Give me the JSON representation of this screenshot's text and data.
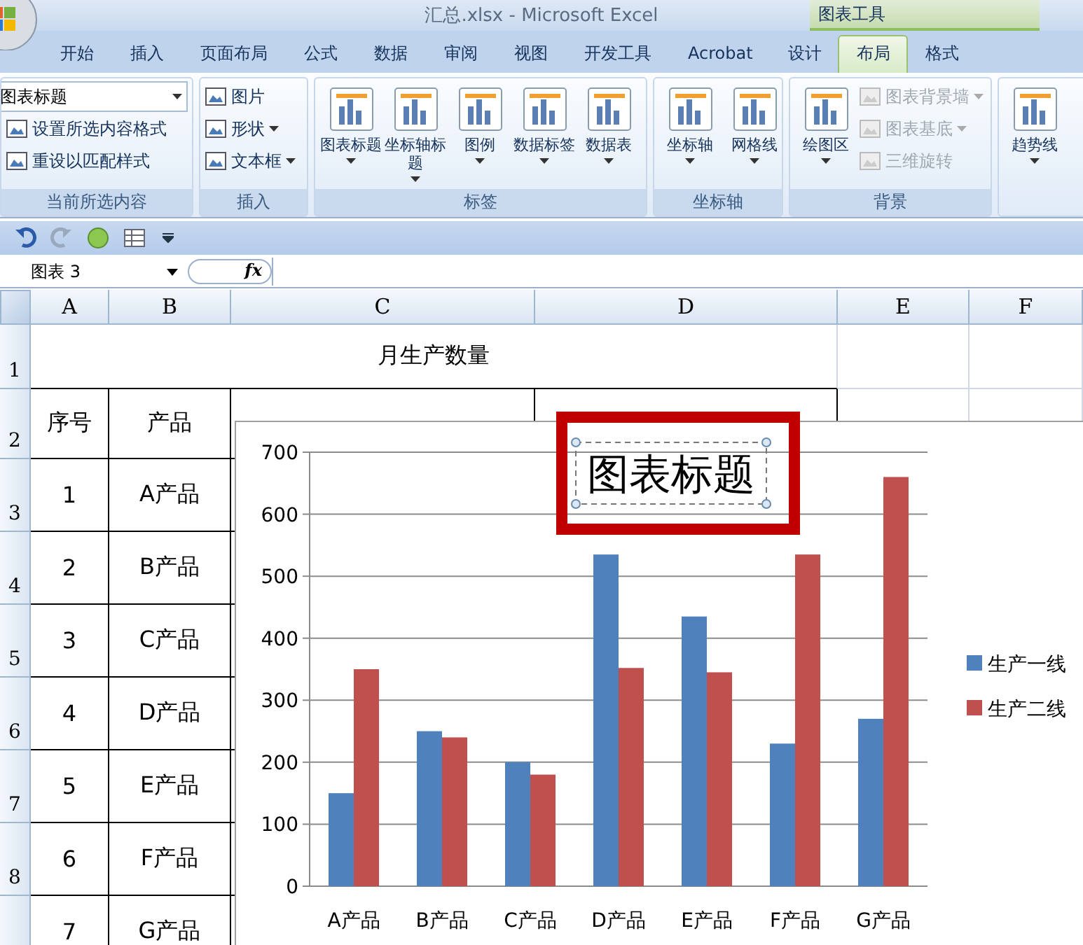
{
  "window": {
    "title": "汇总.xlsx - Microsoft Excel"
  },
  "contextual_group": "图表工具",
  "tabs": [
    {
      "label": "开始",
      "selected": false,
      "contextual": false
    },
    {
      "label": "插入",
      "selected": false,
      "contextual": false
    },
    {
      "label": "页面布局",
      "selected": false,
      "contextual": false
    },
    {
      "label": "公式",
      "selected": false,
      "contextual": false
    },
    {
      "label": "数据",
      "selected": false,
      "contextual": false
    },
    {
      "label": "审阅",
      "selected": false,
      "contextual": false
    },
    {
      "label": "视图",
      "selected": false,
      "contextual": false
    },
    {
      "label": "开发工具",
      "selected": false,
      "contextual": false
    },
    {
      "label": "Acrobat",
      "selected": false,
      "contextual": false
    },
    {
      "label": "设计",
      "selected": false,
      "contextual": true
    },
    {
      "label": "布局",
      "selected": true,
      "contextual": true
    },
    {
      "label": "格式",
      "selected": false,
      "contextual": true
    }
  ],
  "ribbon": [
    {
      "label": "当前所选内容",
      "items": [
        {
          "kind": "combo",
          "label": "图表标题"
        },
        {
          "kind": "small",
          "label": "设置所选内容格式",
          "dropdown": false,
          "disabled": false
        },
        {
          "kind": "small",
          "label": "重设以匹配样式",
          "dropdown": false,
          "disabled": false
        }
      ]
    },
    {
      "label": "插入",
      "items": [
        {
          "kind": "small",
          "label": "图片",
          "dropdown": false,
          "disabled": false
        },
        {
          "kind": "small",
          "label": "形状",
          "dropdown": true,
          "disabled": false
        },
        {
          "kind": "small",
          "label": "文本框",
          "dropdown": true,
          "disabled": false
        }
      ]
    },
    {
      "label": "标签",
      "items": [
        {
          "kind": "large",
          "label": "图表标题",
          "dropdown": true
        },
        {
          "kind": "large",
          "label": "坐标轴标题",
          "dropdown": true
        },
        {
          "kind": "large",
          "label": "图例",
          "dropdown": true
        },
        {
          "kind": "large",
          "label": "数据标签",
          "dropdown": true
        },
        {
          "kind": "large",
          "label": "数据表",
          "dropdown": true
        }
      ]
    },
    {
      "label": "坐标轴",
      "items": [
        {
          "kind": "large",
          "label": "坐标轴",
          "dropdown": true
        },
        {
          "kind": "large",
          "label": "网格线",
          "dropdown": true
        }
      ]
    },
    {
      "label": "背景",
      "items": [
        {
          "kind": "large",
          "label": "绘图区",
          "dropdown": true
        },
        {
          "kind": "small",
          "label": "图表背景墙",
          "dropdown": true,
          "disabled": true
        },
        {
          "kind": "small",
          "label": "图表基底",
          "dropdown": true,
          "disabled": true
        },
        {
          "kind": "small",
          "label": "三维旋转",
          "dropdown": false,
          "disabled": true
        }
      ]
    },
    {
      "items": [
        {
          "kind": "large",
          "label": "趋势线",
          "dropdown": true
        }
      ]
    }
  ],
  "name_box": "图表 3",
  "formula_label": "fx",
  "sheet": {
    "columns": [
      "A",
      "B",
      "C",
      "D",
      "E",
      "F"
    ],
    "row_numbers": [
      "1",
      "2",
      "3",
      "4",
      "5",
      "6",
      "7",
      "8"
    ],
    "title": "月生产数量",
    "header": [
      "序号",
      "产品"
    ],
    "rows": [
      [
        "1",
        "A产品"
      ],
      [
        "2",
        "B产品"
      ],
      [
        "3",
        "C产品"
      ],
      [
        "4",
        "D产品"
      ],
      [
        "5",
        "E产品"
      ],
      [
        "6",
        "F产品"
      ],
      [
        "7",
        "G产品"
      ]
    ]
  },
  "chart": {
    "title": "图表标题",
    "title_selected": true,
    "chart_data": {
      "type": "bar",
      "categories": [
        "A产品",
        "B产品",
        "C产品",
        "D产品",
        "E产品",
        "F产品",
        "G产品"
      ],
      "series": [
        {
          "name": "生产一线",
          "color": "#4f81bd",
          "values": [
            150,
            250,
            200,
            535,
            435,
            230,
            270
          ]
        },
        {
          "name": "生产二线",
          "color": "#c0504d",
          "values": [
            350,
            240,
            180,
            352,
            345,
            535,
            660
          ]
        }
      ],
      "grid": true,
      "legend": true,
      "ylim": [
        0,
        700
      ],
      "yticks": [
        0,
        100,
        200,
        300,
        400,
        500,
        600,
        700
      ]
    }
  }
}
